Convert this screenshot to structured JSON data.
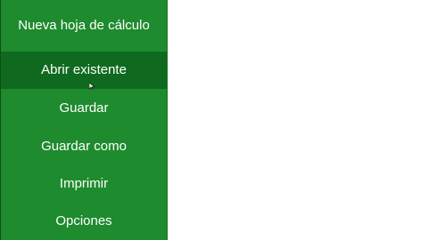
{
  "sidebar": {
    "items": [
      {
        "label": "Nueva hoja de cálculo"
      },
      {
        "label": "Abrir existente"
      },
      {
        "label": "Guardar"
      },
      {
        "label": "Guardar como"
      },
      {
        "label": "Imprimir"
      },
      {
        "label": "Opciones"
      }
    ]
  },
  "colors": {
    "sidebar_bg": "#1e8b2e",
    "active_bg": "#0f6a1f",
    "text": "#ffffff"
  },
  "cursor": {
    "icon": "pointer-cursor-icon"
  }
}
